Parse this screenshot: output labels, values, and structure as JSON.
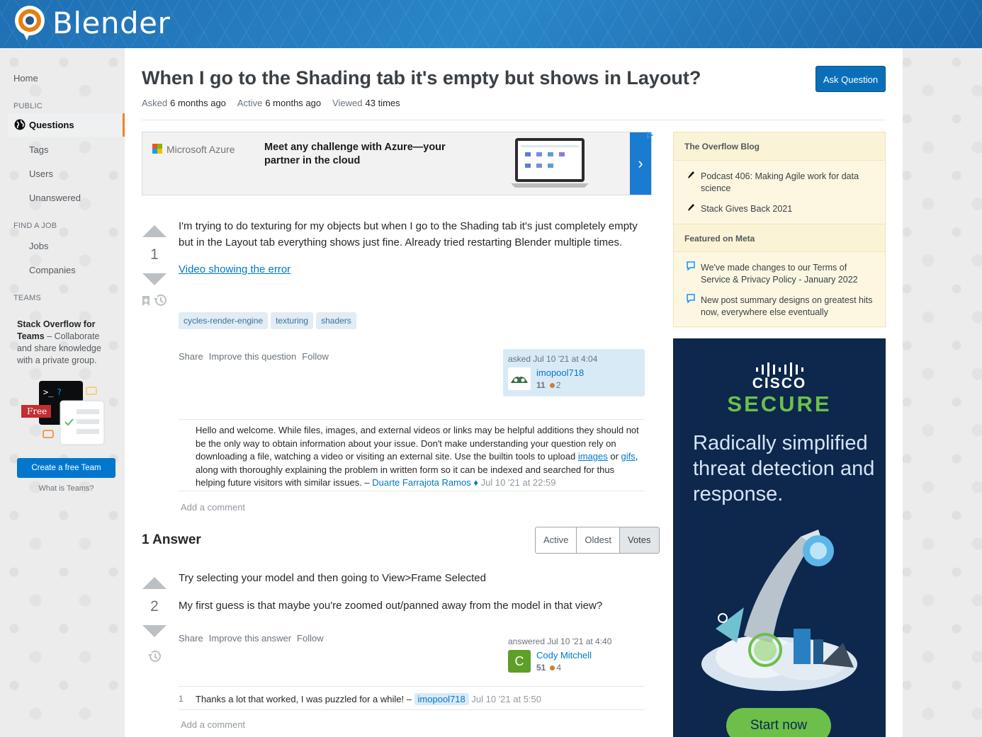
{
  "header": {
    "brand": "Blender"
  },
  "sidebar": {
    "home": "Home",
    "public_label": "PUBLIC",
    "questions": "Questions",
    "tags": "Tags",
    "users": "Users",
    "unanswered": "Unanswered",
    "find_job_label": "FIND A JOB",
    "jobs": "Jobs",
    "companies": "Companies",
    "teams_label": "TEAMS",
    "teams_title": "Stack Overflow for Teams",
    "teams_desc": " – Collaborate and share knowledge with a private group.",
    "free_badge": "Free",
    "create_team": "Create a free Team",
    "what_is_teams": "What is Teams?"
  },
  "question": {
    "title": "When I go to the Shading tab it's empty but shows in Layout?",
    "ask_button": "Ask Question",
    "asked_label": "Asked",
    "asked_value": "6 months ago",
    "active_label": "Active",
    "active_value": "6 months ago",
    "viewed_label": "Viewed",
    "viewed_value": "43 times",
    "votes": "1",
    "body": "I'm trying to do texturing for my objects but when I go to the Shading tab it's just completely empty but in the Layout tab everything shows just fine. Already tried restarting Blender multiple times.",
    "link": "Video showing the error",
    "tags": [
      "cycles-render-engine",
      "texturing",
      "shaders"
    ],
    "menu": [
      "Share",
      "Improve this question",
      "Follow"
    ],
    "asked_when": "asked Jul 10 '21 at 4:04",
    "user": "imopool718",
    "user_rep": "11",
    "user_bronze": "2",
    "comment": {
      "text_a": "Hello and welcome. While files, images, and external videos or links may be helpful additions they should not be the only way to obtain information about your issue. Don't make understanding your question rely on downloading a file, watching a video or visiting an external site. Use the builtin tools to upload ",
      "link1": "images",
      "text_b": " or ",
      "link2": "gifs",
      "text_c": ", along with thoroughly explaining the problem in written form so it can be indexed and searched for thus helping future visitors with similar issues. – ",
      "author": "Duarte Farrajota Ramos",
      "mod": "♦",
      "date": "Jul 10 '21 at 22:59"
    },
    "add_comment": "Add a comment"
  },
  "ad": {
    "brand": "Microsoft Azure",
    "headline": "Meet any challenge with Azure—your partner in the cloud",
    "arrow": "›"
  },
  "answers": {
    "heading": "1 Answer",
    "sort": [
      "Active",
      "Oldest",
      "Votes"
    ],
    "answer": {
      "votes": "2",
      "line1": "Try selecting your model and then going to View>Frame Selected",
      "line2": "My first guess is that maybe you're zoomed out/panned away from the model in that view?",
      "menu": [
        "Share",
        "Improve this answer",
        "Follow"
      ],
      "answered_when": "answered Jul 10 '21 at 4:40",
      "avatar_letter": "C",
      "user": "Cody Mitchell",
      "user_rep": "51",
      "user_bronze": "4",
      "comment_score": "1",
      "comment_text": "Thanks a lot that worked, I was puzzled for a while! – ",
      "comment_author": "imopool718",
      "comment_date": "Jul 10 '21 at 5:50",
      "add_comment": "Add a comment"
    }
  },
  "right_rail": {
    "blog_heading": "The Overflow Blog",
    "blog_items": [
      "Podcast 406: Making Agile work for data science",
      "Stack Gives Back 2021"
    ],
    "meta_heading": "Featured on Meta",
    "meta_items": [
      "We've made changes to our Terms of Service & Privacy Policy - January 2022",
      "New post summary designs on greatest hits now, everywhere else eventually"
    ],
    "cisco_brand": "CISCO",
    "cisco_secure": "SECURE",
    "cisco_tagline": "Radically simplified threat detection and response.",
    "cisco_cta": "Start now"
  },
  "colors": {
    "accent": "#0077cc",
    "active_border": "#f48024",
    "tag_bg": "#e1ecf4",
    "cisco_green": "#6cc04a"
  }
}
